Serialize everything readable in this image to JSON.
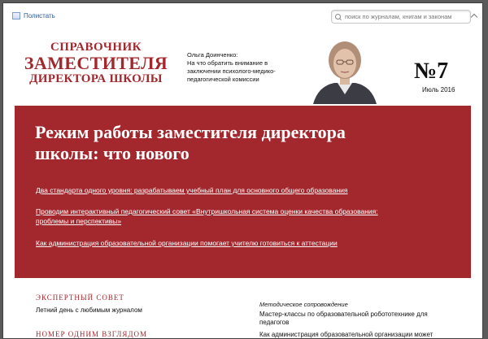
{
  "toolbar": {
    "flip_label": "Полистать",
    "search_placeholder": "поиск по журналам, книгам и законам"
  },
  "header": {
    "mag_line1": "СПРАВОЧНИК",
    "mag_line2": "ЗАМЕСТИТЕЛЯ",
    "mag_line3": "ДИРЕКТОРА ШКОЛЫ",
    "author_name": "Ольга Доинченко:",
    "author_text": "На что обратить внимание в заключении психолого-медико-педагогической комиссии",
    "issue_number": "№7",
    "issue_date": "Июль 2016"
  },
  "hero": {
    "title": "Режим работы заместителя директора школы: что нового",
    "links": [
      "Два стандарта одного уровня: разрабатываем учебный план для основного общего образования",
      "Проводим интерактивный педагогический совет «Внутришкольная система оценки качества образования: проблемы и перспективы»",
      "Как администрация образовательной организации помогает учителю готовиться к аттестации"
    ]
  },
  "bottom": {
    "section1_head": "ЭКСПЕРТНЫЙ СОВЕТ",
    "section1_item": "Летний день с любимым журналом",
    "section2_head": "НОМЕР ОДНИМ ВЗГЛЯДОМ",
    "right_category": "Методическое сопровождение",
    "right_item1": "Мастер-классы по образовательной робототехнике для педагогов",
    "right_item2": "Как администрация образовательной организации может"
  },
  "colors": {
    "brand_red": "#a3282e",
    "link_blue": "#2a5aa8"
  }
}
